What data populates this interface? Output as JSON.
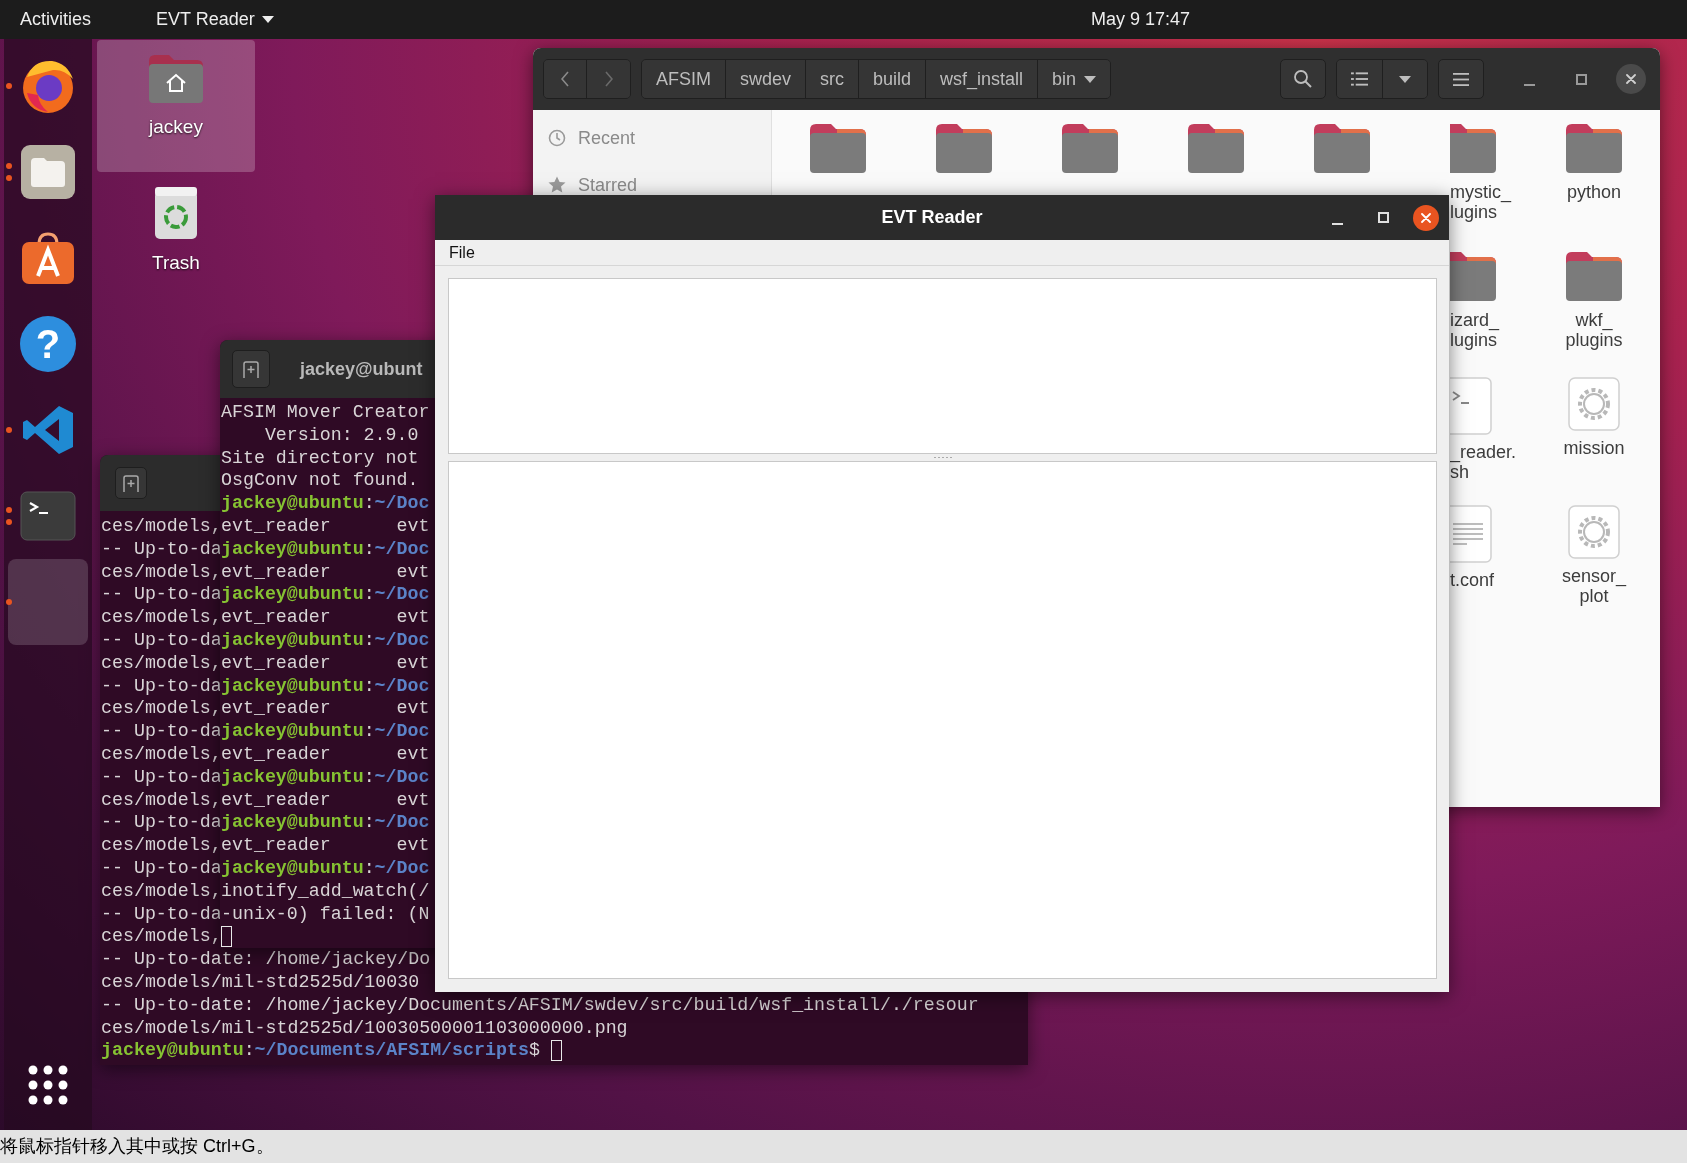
{
  "top_bar": {
    "activities": "Activities",
    "app_menu": "EVT Reader",
    "clock": "May 9  17:47"
  },
  "dock": {
    "items": [
      {
        "kind": "firefox",
        "running": true,
        "multiple": false,
        "selected": false
      },
      {
        "kind": "files",
        "running": true,
        "multiple": true,
        "selected": false
      },
      {
        "kind": "software",
        "running": false,
        "selected": false
      },
      {
        "kind": "help",
        "glyph": "?",
        "running": false,
        "selected": false
      },
      {
        "kind": "vscode",
        "running": true,
        "multiple": false,
        "selected": false
      },
      {
        "kind": "terminal",
        "running": true,
        "multiple": true,
        "selected": false
      },
      {
        "kind": "blank",
        "running": true,
        "multiple": false,
        "selected": true
      }
    ]
  },
  "desktop_icons": [
    {
      "label": "jackey",
      "kind": "home",
      "selected": true
    },
    {
      "label": "Trash",
      "kind": "trash",
      "selected": false
    }
  ],
  "file_manager": {
    "pathbar": [
      "AFSIM",
      "swdev",
      "src",
      "build",
      "wsf_install",
      "bin"
    ],
    "sidebar": [
      {
        "label": "Recent",
        "kind": "recent"
      },
      {
        "label": "Starred",
        "kind": "starred"
      }
    ],
    "rows": [
      [
        {
          "kind": "folder"
        },
        {
          "kind": "folder"
        },
        {
          "kind": "folder"
        },
        {
          "kind": "folder"
        },
        {
          "kind": "folder"
        },
        {
          "label": "mystic_\nlugins",
          "kind": "folder"
        },
        {
          "label": "python",
          "kind": "folder"
        }
      ],
      [
        {
          "label": "izard_\nlugins",
          "kind": "folder"
        },
        {
          "label": "wkf_\nplugins",
          "kind": "folder"
        }
      ],
      [
        {
          "label": "_reader.\nsh",
          "kind": "script"
        },
        {
          "label": "mission",
          "kind": "gear"
        }
      ],
      [
        {
          "label": "t.conf",
          "kind": "text"
        },
        {
          "label": "sensor_\nplot",
          "kind": "gear"
        }
      ]
    ]
  },
  "terminals": [
    {
      "lines": [
        {
          "spans": [
            {
              "kind": "plain",
              "text": "ces/models,"
            }
          ]
        },
        {
          "spans": [
            {
              "kind": "plain",
              "text": "-- Up-to-da"
            }
          ]
        },
        {
          "spans": [
            {
              "kind": "plain",
              "text": "ces/models,"
            }
          ]
        },
        {
          "spans": [
            {
              "kind": "plain",
              "text": "-- Up-to-da"
            }
          ]
        },
        {
          "spans": [
            {
              "kind": "plain",
              "text": "ces/models,"
            }
          ]
        },
        {
          "spans": [
            {
              "kind": "plain",
              "text": "-- Up-to-da"
            }
          ]
        },
        {
          "spans": [
            {
              "kind": "plain",
              "text": "ces/models,"
            }
          ]
        },
        {
          "spans": [
            {
              "kind": "plain",
              "text": "-- Up-to-da"
            }
          ]
        },
        {
          "spans": [
            {
              "kind": "plain",
              "text": "ces/models,"
            }
          ]
        },
        {
          "spans": [
            {
              "kind": "plain",
              "text": "-- Up-to-da"
            }
          ]
        },
        {
          "spans": [
            {
              "kind": "plain",
              "text": "ces/models,"
            }
          ]
        },
        {
          "spans": [
            {
              "kind": "plain",
              "text": "-- Up-to-da"
            }
          ]
        },
        {
          "spans": [
            {
              "kind": "plain",
              "text": "ces/models,"
            }
          ]
        },
        {
          "spans": [
            {
              "kind": "plain",
              "text": "-- Up-to-da"
            }
          ]
        },
        {
          "spans": [
            {
              "kind": "plain",
              "text": "ces/models,"
            }
          ]
        },
        {
          "spans": [
            {
              "kind": "plain",
              "text": "-- Up-to-da"
            }
          ]
        },
        {
          "spans": [
            {
              "kind": "plain",
              "text": "ces/models,"
            }
          ]
        },
        {
          "spans": [
            {
              "kind": "plain",
              "text": "-- Up-to-da"
            }
          ]
        },
        {
          "spans": [
            {
              "kind": "plain",
              "text": "ces/models,"
            }
          ]
        },
        {
          "spans": [
            {
              "kind": "plain",
              "text": "-- Up-to-date: /home/jackey/Do"
            }
          ]
        },
        {
          "spans": [
            {
              "kind": "plain",
              "text": "ces/models/mil-std2525d/10030"
            }
          ]
        },
        {
          "spans": [
            {
              "kind": "plain",
              "text": "-- Up-to-date: /home/jackey/Documents/AFSIM/swdev/src/build/wsf_install/./resour"
            }
          ]
        },
        {
          "spans": [
            {
              "kind": "plain",
              "text": "ces/models/mil-std2525d/10030500001103000000.png"
            }
          ]
        },
        {
          "spans": [
            {
              "kind": "user",
              "text": "jackey@ubuntu"
            },
            {
              "kind": "plain",
              "text": ":"
            },
            {
              "kind": "path",
              "text": "~/Documents/AFSIM/scripts"
            },
            {
              "kind": "plain",
              "text": "$"
            }
          ],
          "cursor": true
        }
      ]
    },
    {
      "title": "jackey@ubunt",
      "lines": [
        {
          "spans": [
            {
              "kind": "plain",
              "text": "AFSIM Mover Creator"
            }
          ]
        },
        {
          "spans": [
            {
              "kind": "plain",
              "text": "    Version: 2.9.0"
            }
          ]
        },
        {
          "spans": [
            {
              "kind": "plain",
              "text": "Site directory not"
            }
          ]
        },
        {
          "spans": [
            {
              "kind": "plain",
              "text": "OsgConv not found."
            }
          ]
        },
        {
          "spans": [
            {
              "kind": "user",
              "text": "jackey@ubuntu"
            },
            {
              "kind": "plain",
              "text": ":"
            },
            {
              "kind": "path",
              "text": "~/Doc"
            }
          ]
        },
        {
          "spans": [
            {
              "kind": "plain",
              "text": "evt_reader      evt"
            }
          ]
        },
        {
          "spans": [
            {
              "kind": "user",
              "text": "jackey@ubuntu"
            },
            {
              "kind": "plain",
              "text": ":"
            },
            {
              "kind": "path",
              "text": "~/Doc"
            }
          ]
        },
        {
          "spans": [
            {
              "kind": "plain",
              "text": "evt_reader      evt"
            }
          ]
        },
        {
          "spans": [
            {
              "kind": "user",
              "text": "jackey@ubuntu"
            },
            {
              "kind": "plain",
              "text": ":"
            },
            {
              "kind": "path",
              "text": "~/Doc"
            }
          ]
        },
        {
          "spans": [
            {
              "kind": "plain",
              "text": "evt_reader      evt"
            }
          ]
        },
        {
          "spans": [
            {
              "kind": "user",
              "text": "jackey@ubuntu"
            },
            {
              "kind": "plain",
              "text": ":"
            },
            {
              "kind": "path",
              "text": "~/Doc"
            }
          ]
        },
        {
          "spans": [
            {
              "kind": "plain",
              "text": "evt_reader      evt"
            }
          ]
        },
        {
          "spans": [
            {
              "kind": "user",
              "text": "jackey@ubuntu"
            },
            {
              "kind": "plain",
              "text": ":"
            },
            {
              "kind": "path",
              "text": "~/Doc"
            }
          ]
        },
        {
          "spans": [
            {
              "kind": "plain",
              "text": "evt_reader      evt"
            }
          ]
        },
        {
          "spans": [
            {
              "kind": "user",
              "text": "jackey@ubuntu"
            },
            {
              "kind": "plain",
              "text": ":"
            },
            {
              "kind": "path",
              "text": "~/Doc"
            }
          ]
        },
        {
          "spans": [
            {
              "kind": "plain",
              "text": "evt_reader      evt"
            }
          ]
        },
        {
          "spans": [
            {
              "kind": "user",
              "text": "jackey@ubuntu"
            },
            {
              "kind": "plain",
              "text": ":"
            },
            {
              "kind": "path",
              "text": "~/Doc"
            }
          ]
        },
        {
          "spans": [
            {
              "kind": "plain",
              "text": "evt_reader      evt"
            }
          ]
        },
        {
          "spans": [
            {
              "kind": "user",
              "text": "jackey@ubuntu"
            },
            {
              "kind": "plain",
              "text": ":"
            },
            {
              "kind": "path",
              "text": "~/Doc"
            }
          ]
        },
        {
          "spans": [
            {
              "kind": "plain",
              "text": "evt_reader      evt"
            }
          ]
        },
        {
          "spans": [
            {
              "kind": "user",
              "text": "jackey@ubuntu"
            },
            {
              "kind": "plain",
              "text": ":"
            },
            {
              "kind": "path",
              "text": "~/Doc"
            }
          ]
        },
        {
          "spans": [
            {
              "kind": "plain",
              "text": "inotify_add_watch(/"
            }
          ]
        },
        {
          "spans": [
            {
              "kind": "plain",
              "text": "-unix-0) failed: (N"
            }
          ]
        },
        {
          "cursor": true
        }
      ]
    }
  ],
  "evt_reader": {
    "title": "EVT Reader",
    "menu": [
      "File"
    ]
  },
  "status_bar": {
    "text": "将鼠标指针移入其中或按 Ctrl+G。"
  }
}
